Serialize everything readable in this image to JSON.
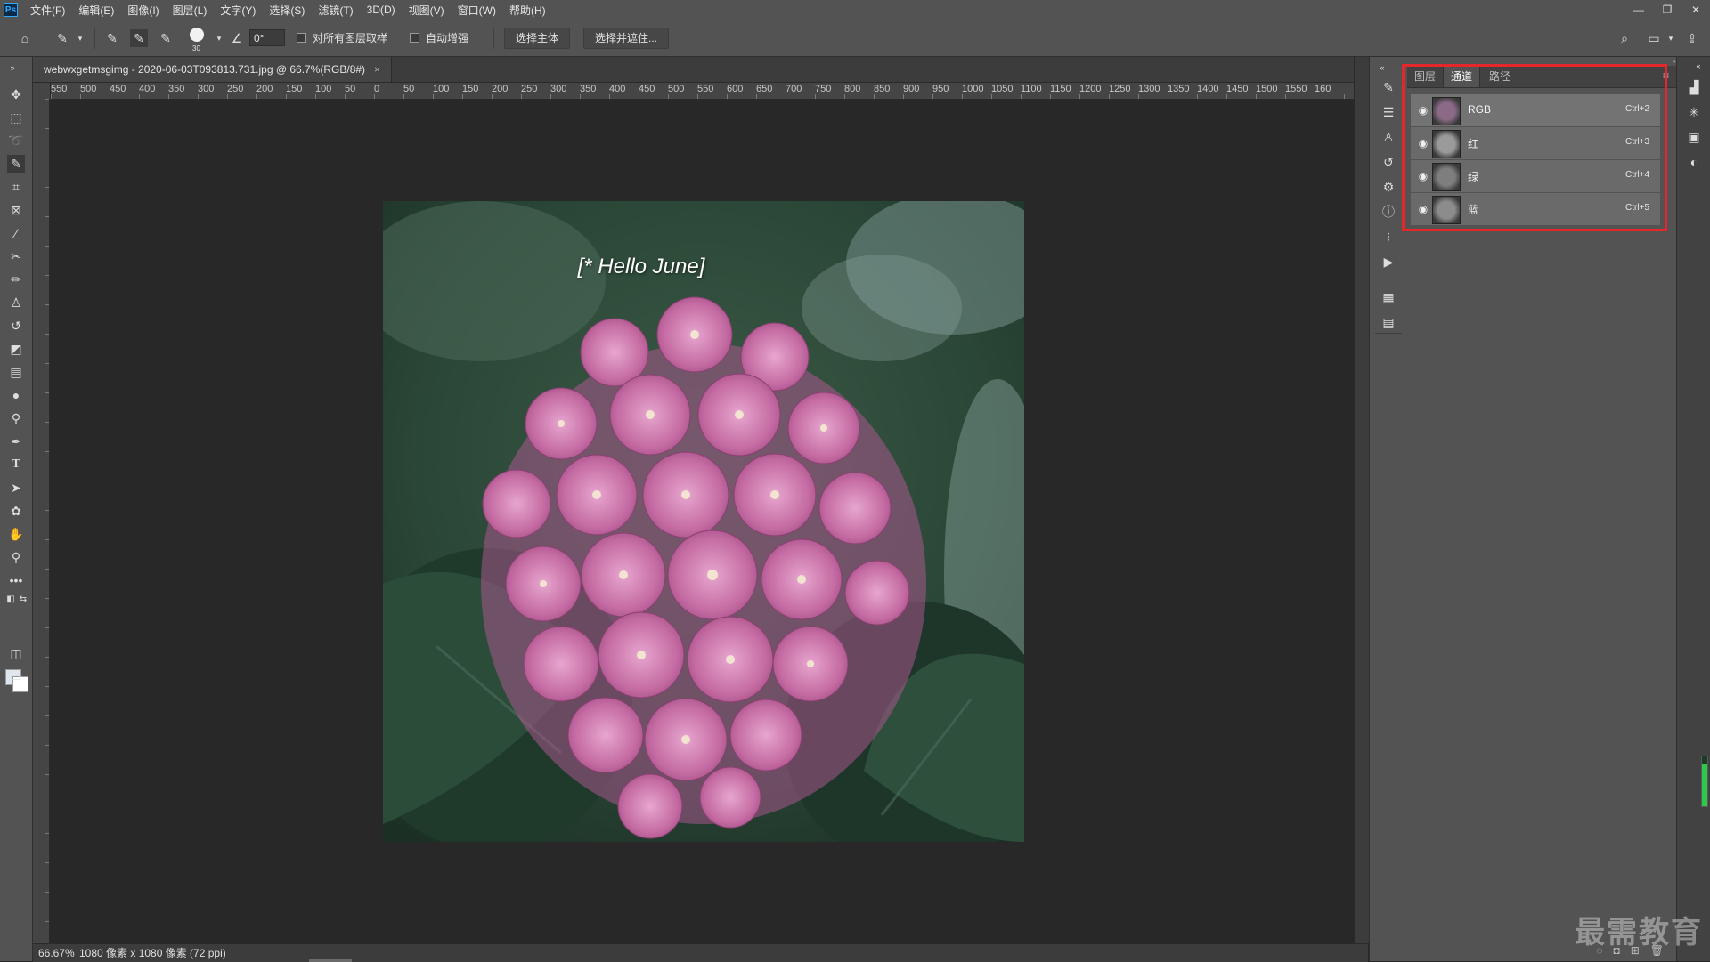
{
  "app": {
    "logo": "Ps",
    "menu": [
      "文件(F)",
      "编辑(E)",
      "图像(I)",
      "图层(L)",
      "文字(Y)",
      "选择(S)",
      "滤镜(T)",
      "3D(D)",
      "视图(V)",
      "窗口(W)",
      "帮助(H)"
    ],
    "window_controls": [
      "—",
      "❐",
      "✕"
    ]
  },
  "options": {
    "brush_size": "30",
    "angle": "0°",
    "sample_all_layers": "对所有图层取样",
    "auto_enhance": "自动增强",
    "select_subject": "选择主体",
    "select_and_mask": "选择并遮住..."
  },
  "document": {
    "tab_title": "webwxgetmsgimg - 2020-06-03T093813.731.jpg @ 66.7%(RGB/8#)",
    "tab_close": "×",
    "overlay_text": "[* Hello June]"
  },
  "ruler": {
    "h_labels": [
      "550",
      "500",
      "450",
      "400",
      "350",
      "300",
      "250",
      "200",
      "150",
      "100",
      "50",
      "0",
      "50",
      "100",
      "150",
      "200",
      "250",
      "300",
      "350",
      "400",
      "450",
      "500",
      "550",
      "600",
      "650",
      "700",
      "750",
      "800",
      "850",
      "900",
      "950",
      "1000",
      "1050",
      "1100",
      "1150",
      "1200",
      "1250",
      "1300",
      "1350",
      "1400",
      "1450",
      "1500",
      "1550",
      "160"
    ]
  },
  "status": {
    "zoom": "66.67%",
    "info": "1080 像素 x 1080 像素 (72 ppi)"
  },
  "panel": {
    "tabs": [
      "图层",
      "通道",
      "路径"
    ],
    "active_tab": "通道",
    "menu_icon": "≡",
    "channels": [
      {
        "name": "RGB",
        "shortcut": "Ctrl+2",
        "thumb_color": "#8a6a86"
      },
      {
        "name": "红",
        "shortcut": "Ctrl+3",
        "thumb_color": "#9a9a9a"
      },
      {
        "name": "绿",
        "shortcut": "Ctrl+4",
        "thumb_color": "#7e7e7e"
      },
      {
        "name": "蓝",
        "shortcut": "Ctrl+5",
        "thumb_color": "#8c8c8c"
      }
    ],
    "highlight_color": "#e5262b"
  },
  "watermark": "最需教育",
  "colors": {
    "foreground": "#dfe6ee",
    "background": "#ffffff",
    "flower_pink": "#c86aa6",
    "leaf_green": "#2f4a3b"
  }
}
